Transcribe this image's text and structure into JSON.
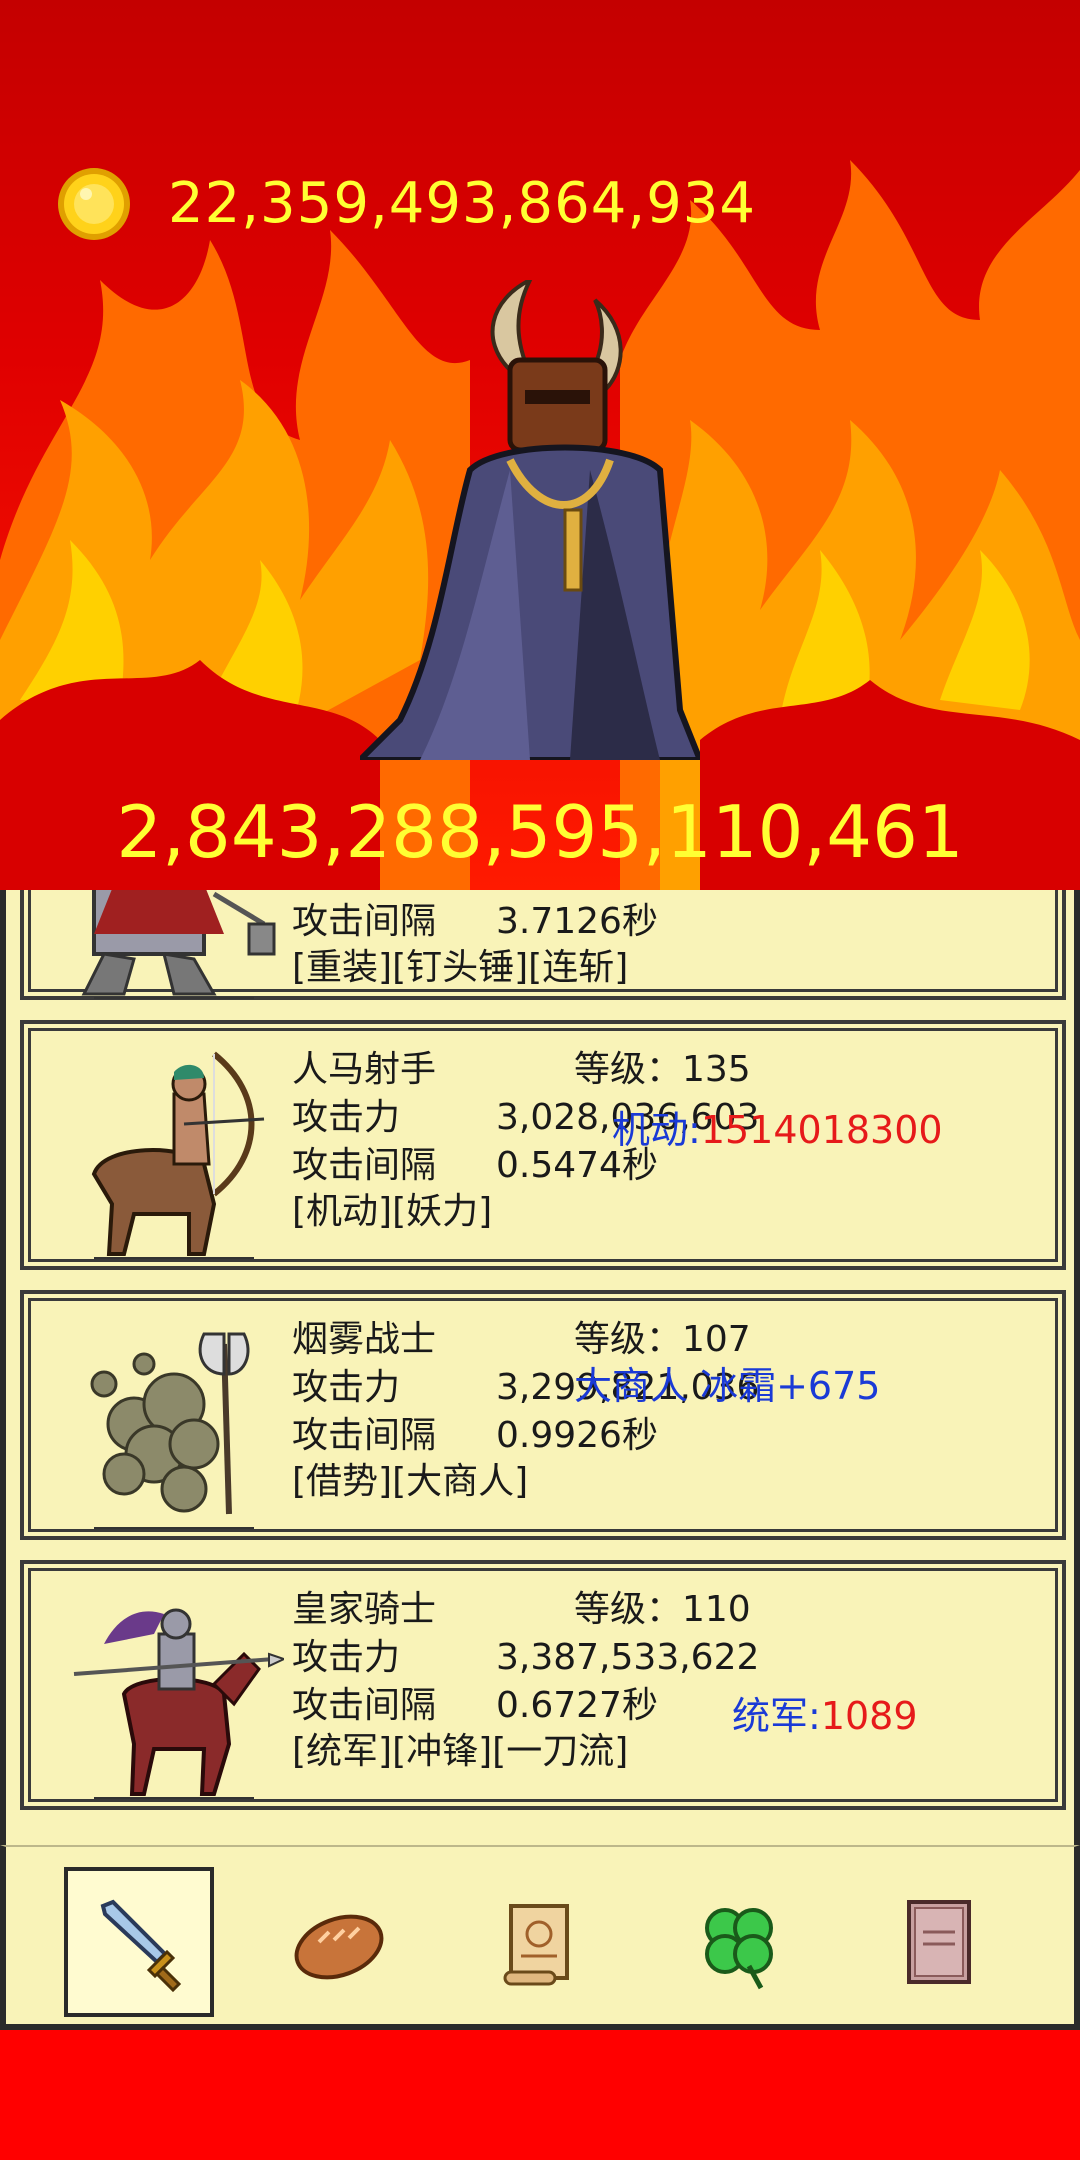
{
  "header": {
    "gold_amount": "22,359,493,864,934",
    "boss_hp": "2,843,288,595,110,461"
  },
  "units": [
    {
      "attack_interval_label": "攻击间隔",
      "attack_interval": "3.7126秒",
      "traits": "[重装][钉头锤][连斩]",
      "portrait_icon": "armored-mace-knight-icon"
    },
    {
      "name": "人马射手",
      "level_label": "等级：135",
      "attack_label": "攻击力",
      "attack": "3,028,036,603",
      "attack_interval_label": "攻击间隔",
      "attack_interval": "0.5474秒",
      "traits": "[机动][妖力]",
      "popup_label": "机动:",
      "popup_value": "1514018300",
      "portrait_icon": "centaur-archer-icon"
    },
    {
      "name": "烟雾战士",
      "level_label": "等级：107",
      "attack_label": "攻击力",
      "attack": "3,299,821,036",
      "attack_interval_label": "攻击间隔",
      "attack_interval": "0.9926秒",
      "traits": "[借势][大商人]",
      "popup_label": "大商人 冰霜+675",
      "portrait_icon": "smoke-warrior-icon"
    },
    {
      "name": "皇家骑士",
      "level_label": "等级：110",
      "attack_label": "攻击力",
      "attack": "3,387,533,622",
      "attack_interval_label": "攻击间隔",
      "attack_interval": "0.6727秒",
      "traits": "[统军][冲锋][一刀流]",
      "popup_label": "统军:",
      "popup_value": "1089",
      "portrait_icon": "royal-knight-icon"
    }
  ],
  "nav": [
    {
      "icon": "sword-icon",
      "selected": true
    },
    {
      "icon": "bread-icon",
      "selected": false
    },
    {
      "icon": "scroll-icon",
      "selected": false
    },
    {
      "icon": "clover-icon",
      "selected": false
    },
    {
      "icon": "book-icon",
      "selected": false
    }
  ],
  "colors": {
    "background_red": "#ff0000",
    "gold_text": "#ffff33",
    "panel": "#f9f3b8",
    "popup_blue": "#1a3ad6",
    "popup_red": "#e61a1a"
  }
}
